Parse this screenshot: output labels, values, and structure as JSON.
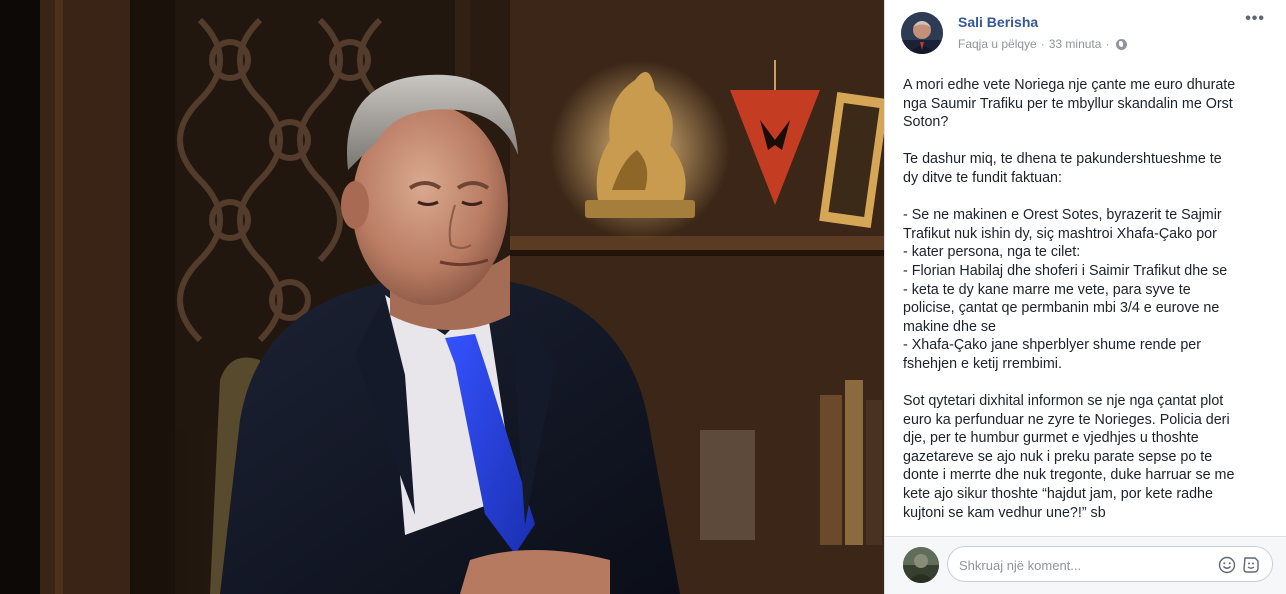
{
  "post": {
    "author": "Sali Berisha",
    "page_type": "Faqja u pëlqye",
    "separator": "·",
    "time": "33 minuta",
    "more_label": "•••",
    "paragraphs": [
      [
        "A mori edhe vete Noriega nje çante me euro dhurate",
        "nga Saumir Trafiku per te mbyllur skandalin me Orst",
        "Soton?"
      ],
      [
        "Te dashur miq, te dhena te pakundershtueshme te",
        "dy ditve te fundit faktuan:"
      ],
      [
        "- Se ne makinen e Orest Sotes, byrazerit te Sajmir",
        "Trafikut nuk ishin dy, siç mashtroi Xhafa-Çako por",
        "- kater persona, nga te cilet:",
        "- Florian Habilaj dhe shoferi i Saimir Trafikut dhe se",
        "- keta te dy kane marre me vete, para syve te",
        "policise, çantat qe permbanin mbi 3/4 e eurove ne",
        "makine dhe se",
        "- Xhafa-Çako jane shperblyer shume rende per",
        "fshehjen e ketij rrembimi."
      ],
      [
        "Sot qytetari dixhital informon se nje nga çantat plot",
        "euro ka perfunduar ne zyre te Norieges. Policia deri",
        "dje, per te humbur gurmet e vjedhjes u thoshte",
        "gazetareve se ajo nuk i preku parate sepse po te",
        "donte i merrte dhe nuk tregonte, duke harruar se me",
        "kete ajo sikur thoshte “hajdut jam, por kete radhe",
        "kujtoni se kam vedhur une?!” sb"
      ]
    ]
  },
  "comment": {
    "placeholder": "Shkruaj një koment..."
  },
  "icons": {
    "globe": "globe-icon",
    "emoji": "emoji-icon",
    "sticker": "sticker-icon",
    "more": "more-options-icon"
  },
  "colors": {
    "author_link": "#365899",
    "meta_gray": "#90949c",
    "text": "#1d2129",
    "suit_tie": "#1f3fd6"
  }
}
